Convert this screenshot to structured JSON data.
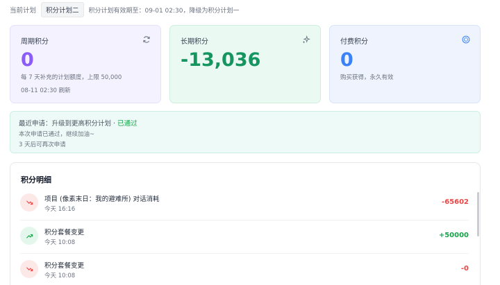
{
  "plan": {
    "current_label": "当前计划",
    "name": "积分计划二",
    "validity": "积分计划有效期至：09-01 02:30，降级为积分计划一"
  },
  "cards": {
    "periodic": {
      "label": "周期积分",
      "value": "0",
      "sub": "每 7 天补充的计划额度，上限 50,000",
      "refresh": "08-11 02:30 刷新",
      "icon": "refresh-icon"
    },
    "longterm": {
      "label": "长期积分",
      "value": "-13,036",
      "icon": "sparkle-icon"
    },
    "paid": {
      "label": "付费积分",
      "value": "0",
      "sub": "购买获得，永久有效",
      "icon": "coin-icon"
    }
  },
  "application": {
    "prefix": "最近申请：升级到更高积分计划 · ",
    "status": "已通过",
    "line2": "本次申请已通过，继续加油~",
    "line3": "3 天后可再次申请"
  },
  "details": {
    "title": "积分明细",
    "rows": [
      {
        "title": "项目 (像素末日：我的避难所) 对话消耗",
        "time": "今天 16:16",
        "amount": "-65602",
        "direction": "down"
      },
      {
        "title": "积分套餐变更",
        "time": "今天 10:08",
        "amount": "+50000",
        "direction": "up"
      },
      {
        "title": "积分套餐变更",
        "time": "今天 10:08",
        "amount": "-0",
        "direction": "down"
      }
    ]
  },
  "colors": {
    "purple": "#8b5cf6",
    "green": "#15955f",
    "blue": "#3b82f6",
    "red": "#ef4444"
  }
}
